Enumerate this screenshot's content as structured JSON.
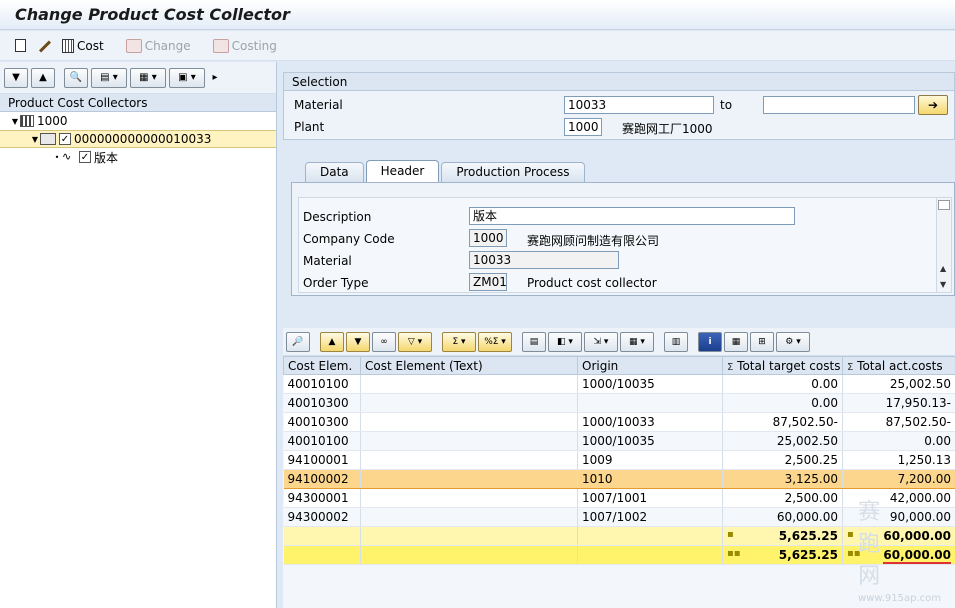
{
  "window": {
    "title": "Change Product Cost Collector"
  },
  "app_toolbar": {
    "cost_label": "Cost",
    "change_label": "Change",
    "costing_label": "Costing"
  },
  "tree": {
    "header": "Product Cost Collectors",
    "plant_node": "1000",
    "collector_node": "000000000000010033",
    "version_node": "版本"
  },
  "selection": {
    "title": "Selection",
    "material_label": "Material",
    "material_value": "10033",
    "to_label": "to",
    "to_value": "",
    "plant_label": "Plant",
    "plant_value": "1000",
    "plant_desc": "赛跑网工厂1000"
  },
  "tabs": [
    {
      "label": "Data"
    },
    {
      "label": "Header"
    },
    {
      "label": "Production Process"
    }
  ],
  "header_fields": {
    "description_label": "Description",
    "description_value": "版本",
    "company_code_label": "Company Code",
    "company_code_value": "1000",
    "company_code_desc": "赛跑网顾问制造有限公司",
    "material_label": "Material",
    "material_value": "10033",
    "order_type_label": "Order Type",
    "order_type_value": "ZM01",
    "order_type_desc": "Product cost collector"
  },
  "grid": {
    "columns": [
      "Cost Elem.",
      "Cost Element (Text)",
      "Origin",
      "Total target costs",
      "Total act.costs"
    ],
    "rows": [
      [
        "40010100",
        "",
        "1000/10035",
        "0.00",
        "25,002.50"
      ],
      [
        "40010300",
        "",
        "",
        "0.00",
        "17,950.13-"
      ],
      [
        "40010300",
        "",
        "1000/10033",
        "87,502.50-",
        "87,502.50-"
      ],
      [
        "40010100",
        "",
        "1000/10035",
        "25,002.50",
        "0.00"
      ],
      [
        "94100001",
        "",
        "1009",
        "2,500.25",
        "1,250.13"
      ],
      [
        "94100002",
        "",
        "1010",
        "3,125.00",
        "7,200.00"
      ],
      [
        "94300001",
        "",
        "1007/1001",
        "2,500.00",
        "42,000.00"
      ],
      [
        "94300002",
        "",
        "1007/1002",
        "60,000.00",
        "90,000.00"
      ]
    ],
    "subtotal": {
      "target": "5,625.25",
      "actual": "60,000.00"
    },
    "total": {
      "target": "5,625.25",
      "actual": "60,000.00"
    }
  },
  "watermark": {
    "text": "赛 跑 网",
    "url": "www.915ap.com"
  }
}
